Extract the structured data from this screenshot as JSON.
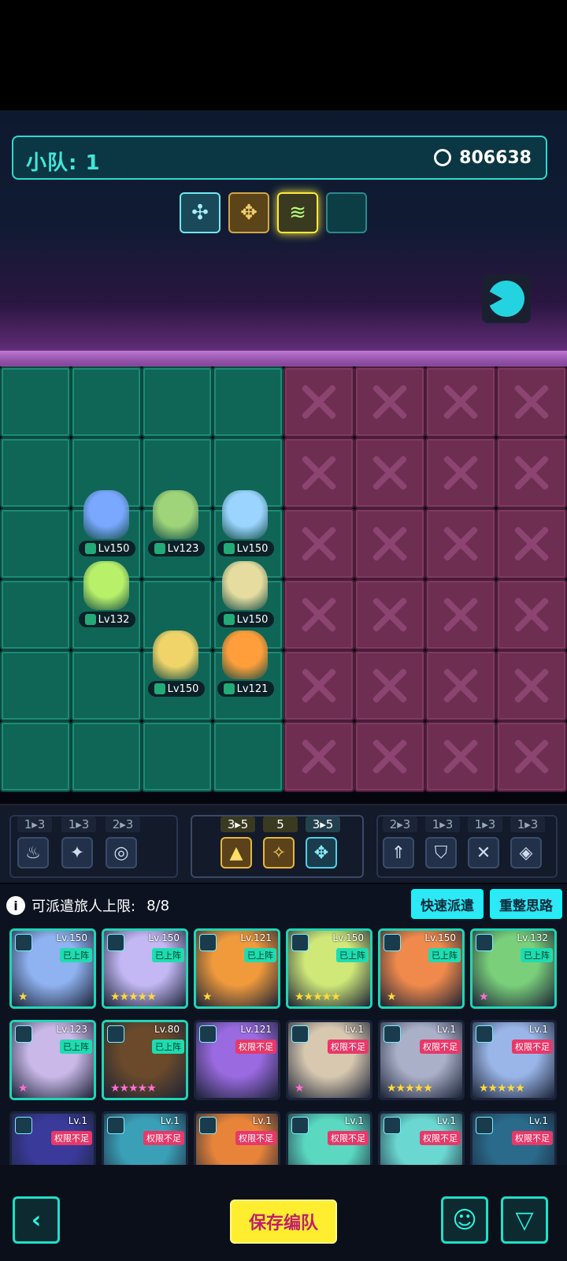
{
  "squad": {
    "label": "小队: 1",
    "power": "806638"
  },
  "formations": [
    "formation-a",
    "formation-b",
    "formation-c-selected",
    "formation-d-empty"
  ],
  "units": [
    {
      "id": "u1",
      "level": "Lv150",
      "color": "#7aa7ff"
    },
    {
      "id": "u2",
      "level": "Lv123",
      "color": "#9fd47a"
    },
    {
      "id": "u3",
      "level": "Lv150",
      "color": "#9ad4ff"
    },
    {
      "id": "u4",
      "level": "Lv132",
      "color": "#b9f06a"
    },
    {
      "id": "u5",
      "level": "Lv150",
      "color": "#e6dca0"
    },
    {
      "id": "u6",
      "level": "Lv150",
      "color": "#f0d46a"
    },
    {
      "id": "u7",
      "level": "Lv121",
      "color": "#ff9e3a"
    }
  ],
  "synergy": {
    "left": [
      {
        "count": "1▸3"
      },
      {
        "count": "1▸3"
      },
      {
        "count": "2▸3"
      }
    ],
    "middle": [
      {
        "count": "3▸5"
      },
      {
        "count": "5"
      },
      {
        "count": "3▸5"
      }
    ],
    "right": [
      {
        "count": "2▸3"
      },
      {
        "count": "1▸3"
      },
      {
        "count": "1▸3"
      },
      {
        "count": "1▸3"
      }
    ]
  },
  "roster": {
    "limit_label": "可派遣旅人上限:",
    "limit_value": "8/8",
    "quick_dispatch": "快速派遣",
    "reorganize": "重整思路",
    "cards": [
      {
        "level": "Lv.150",
        "tag": "已上阵",
        "tag_state": "on",
        "stars": "★",
        "star_color": "gold",
        "color": "#8fb2f0"
      },
      {
        "level": "Lv.150",
        "tag": "已上阵",
        "tag_state": "on",
        "stars": "★★★★★",
        "star_color": "gold",
        "color": "#c3b8f4"
      },
      {
        "level": "Lv.121",
        "tag": "已上阵",
        "tag_state": "on",
        "stars": "★",
        "star_color": "gold",
        "color": "#f09a3c"
      },
      {
        "level": "Lv.150",
        "tag": "已上阵",
        "tag_state": "on",
        "stars": "★★★★★",
        "star_color": "gold",
        "color": "#cfe878"
      },
      {
        "level": "Lv.150",
        "tag": "已上阵",
        "tag_state": "on",
        "stars": "★",
        "star_color": "gold",
        "color": "#f08a4c"
      },
      {
        "level": "Lv.132",
        "tag": "已上阵",
        "tag_state": "on",
        "stars": "★",
        "star_color": "pink",
        "color": "#7ad07a"
      },
      {
        "level": "Lv.123",
        "tag": "已上阵",
        "tag_state": "on",
        "stars": "★",
        "star_color": "pink",
        "color": "#c9b8e8"
      },
      {
        "level": "Lv.80",
        "tag": "已上阵",
        "tag_state": "on",
        "stars": "★★★★★",
        "star_color": "pink",
        "color": "#6a4a2a"
      },
      {
        "level": "Lv.121",
        "tag": "权限不足",
        "tag_state": "off",
        "stars": "",
        "star_color": "gold",
        "color": "#9a6ae0"
      },
      {
        "level": "Lv.1",
        "tag": "权限不足",
        "tag_state": "off",
        "stars": "★",
        "star_color": "pink",
        "color": "#d8c8b0"
      },
      {
        "level": "Lv.1",
        "tag": "权限不足",
        "tag_state": "off",
        "stars": "★★★★★",
        "star_color": "gold",
        "color": "#aab0c8"
      },
      {
        "level": "Lv.1",
        "tag": "权限不足",
        "tag_state": "off",
        "stars": "★★★★★",
        "star_color": "gold",
        "color": "#9ab6e8"
      },
      {
        "level": "Lv.1",
        "tag": "权限不足",
        "tag_state": "off",
        "stars": "",
        "star_color": "gold",
        "color": "#3a3a9a"
      },
      {
        "level": "Lv.1",
        "tag": "权限不足",
        "tag_state": "off",
        "stars": "",
        "star_color": "gold",
        "color": "#3aa0b8"
      },
      {
        "level": "Lv.1",
        "tag": "权限不足",
        "tag_state": "off",
        "stars": "",
        "star_color": "gold",
        "color": "#e8843a"
      },
      {
        "level": "Lv.1",
        "tag": "权限不足",
        "tag_state": "off",
        "stars": "",
        "star_color": "gold",
        "color": "#5ad8c0"
      },
      {
        "level": "Lv.1",
        "tag": "权限不足",
        "tag_state": "off",
        "stars": "",
        "star_color": "gold",
        "color": "#6ad8d0"
      },
      {
        "level": "Lv.1",
        "tag": "权限不足",
        "tag_state": "off",
        "stars": "",
        "star_color": "gold",
        "color": "#2a6a8a"
      }
    ]
  },
  "bottom": {
    "back_glyph": "‹",
    "save_label": "保存编队",
    "filter_glyph": "▽"
  }
}
